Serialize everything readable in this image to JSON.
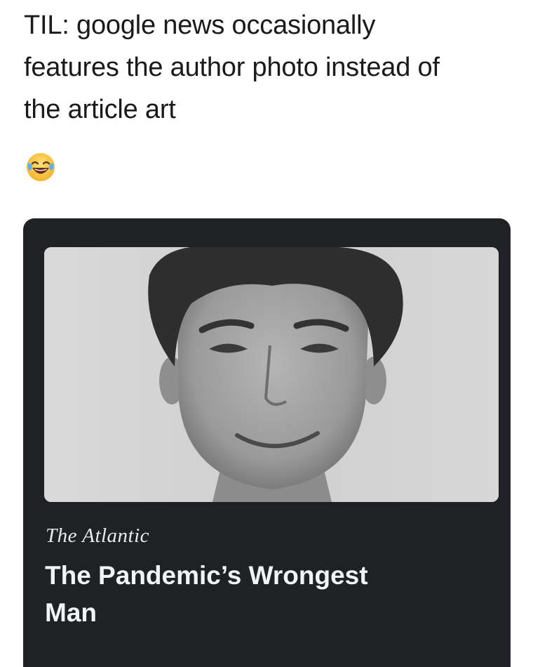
{
  "post": {
    "lines": [
      "TIL: google news occasionally",
      "features the author photo instead of",
      "the article art"
    ],
    "emoji": "face-with-tears-of-joy-icon"
  },
  "news_card": {
    "publisher": "The Atlantic",
    "headline_lines": [
      "The Pandemic’s Wrongest",
      "Man"
    ],
    "image": "author-photo",
    "colors": {
      "card_background": "#202124",
      "text": "#f1f3f4"
    }
  }
}
